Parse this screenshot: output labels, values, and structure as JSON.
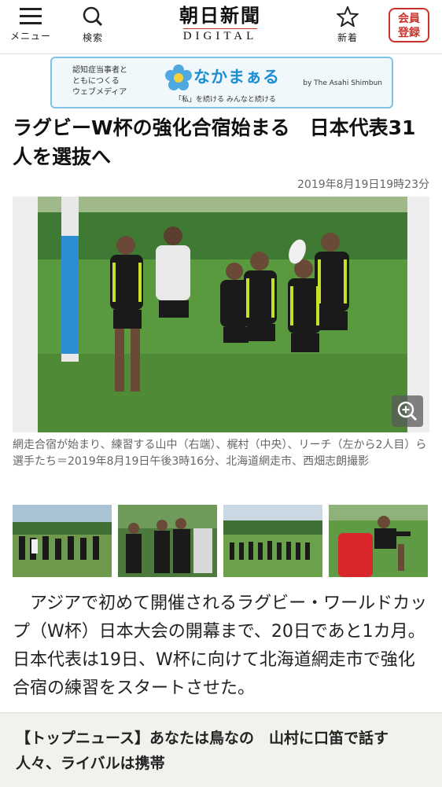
{
  "header": {
    "menu_label": "メニュー",
    "search_label": "検索",
    "logo_jp": "朝日新聞",
    "logo_en": "DIGITAL",
    "favorites_label": "新着",
    "register_line1": "会員",
    "register_line2": "登録"
  },
  "banner": {
    "left_line1": "認知症当事者と",
    "left_line2": "ともにつくる",
    "left_line3": "ウェブメディア",
    "brand": "なかまぁる",
    "tagline": "「私」を続ける みんなと続ける",
    "by": "by The Asahi Shimbun"
  },
  "article": {
    "headline": "ラグビーW杯の強化合宿始まる　日本代表31人を選抜へ",
    "date": "2019年8月19日19時23分",
    "caption": "網走合宿が始まり、練習する山中（右端）、梶村（中央）、リーチ（左から2人目）ら選手たち＝2019年8月19日午後3時16分、北海道網走市、西畑志朗撮影",
    "body": "アジアで初めて開催されるラグビー・ワールドカップ（W杯）日本大会の開幕まで、20日であと1カ月。日本代表は19日、W杯に向けて北海道網走市で強化合宿の練習をスタートさせた。"
  },
  "related": {
    "text": "【トップニュース】あなたは鳥なの　山村に口笛で話す人々、ライバルは携帯"
  },
  "colors": {
    "accent_red": "#c8322a",
    "brand_blue": "#1d8fd1",
    "jersey_black": "#1a1a1a",
    "jersey_yellow": "#c8e02a",
    "grass_green": "#4f8a3a"
  }
}
